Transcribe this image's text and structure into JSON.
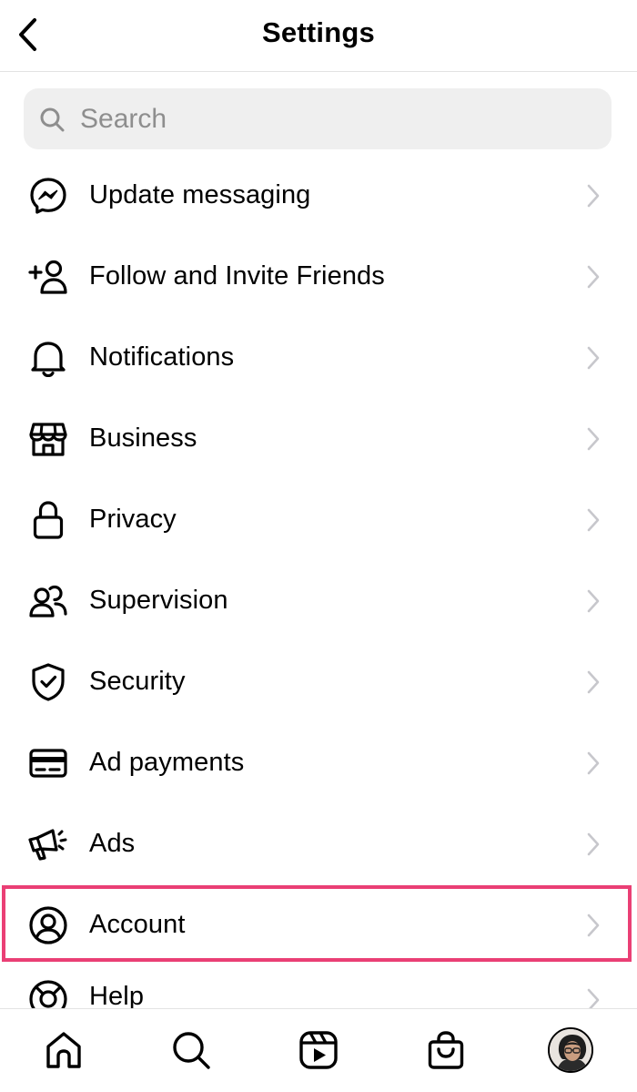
{
  "header": {
    "title": "Settings",
    "back_icon": "chevron-left-icon"
  },
  "search": {
    "placeholder": "Search",
    "value": "",
    "icon": "search-icon"
  },
  "menu": {
    "items": [
      {
        "label": "Update messaging",
        "icon": "messenger-icon"
      },
      {
        "label": "Follow and Invite Friends",
        "icon": "add-person-icon"
      },
      {
        "label": "Notifications",
        "icon": "bell-icon"
      },
      {
        "label": "Business",
        "icon": "storefront-icon"
      },
      {
        "label": "Privacy",
        "icon": "lock-icon"
      },
      {
        "label": "Supervision",
        "icon": "people-icon"
      },
      {
        "label": "Security",
        "icon": "shield-check-icon"
      },
      {
        "label": "Ad payments",
        "icon": "credit-card-icon"
      },
      {
        "label": "Ads",
        "icon": "megaphone-icon"
      },
      {
        "label": "Account",
        "icon": "user-circle-icon",
        "highlighted": true
      },
      {
        "label": "Help",
        "icon": "lifebuoy-icon"
      }
    ]
  },
  "bottom_nav": {
    "items": [
      {
        "name": "home",
        "icon": "home-icon"
      },
      {
        "name": "search",
        "icon": "search-icon"
      },
      {
        "name": "reels",
        "icon": "reels-icon"
      },
      {
        "name": "shop",
        "icon": "shopping-bag-icon"
      },
      {
        "name": "profile",
        "icon": "avatar"
      }
    ]
  },
  "colors": {
    "highlight": "#ea3f75",
    "search_bg": "#efefef",
    "chevron": "#c7c7cc",
    "placeholder": "#8e8e8e"
  }
}
